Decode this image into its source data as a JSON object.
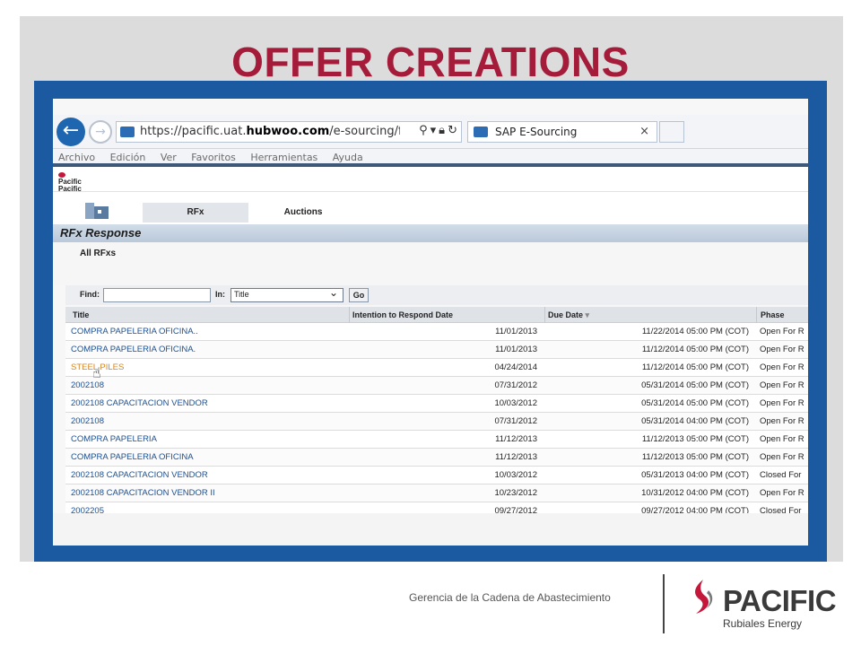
{
  "slide": {
    "title": "OFFER CREATIONS",
    "footer_text": "Gerencia de la Cadena de Abastecimiento",
    "logo": {
      "name": "PACIFIC",
      "tagline": "Rubiales Energy"
    },
    "colors": {
      "title": "#a41c3a",
      "frame": "#1b5aa0",
      "logo_red": "#c3183a"
    }
  },
  "browser": {
    "url_prefix": "https://pacific.uat.",
    "url_domain": "hubwoo.com",
    "url_path": "/e-sourcing/fsvenc",
    "tab_title": "SAP E-Sourcing",
    "tab_close": "×",
    "back_glyph": "←",
    "forward_glyph": "→",
    "address_icons": [
      "search-icon",
      "dropdown-icon",
      "lock-icon",
      "refresh-icon"
    ],
    "menu": [
      "Archivo",
      "Edición",
      "Ver",
      "Favoritos",
      "Herramientas",
      "Ayuda"
    ]
  },
  "app": {
    "logo_small_1": "Pacific",
    "logo_small_2": "Pacific",
    "tabs": [
      "RFx",
      "Auctions"
    ],
    "section_title": "RFx Response",
    "sub_title": "All RFxs",
    "search": {
      "find_label": "Find:",
      "find_value": "",
      "in_label": "In:",
      "in_value": "Title",
      "go_label": "Go"
    },
    "columns": [
      "Title",
      "Intention to Respond Date",
      "Due Date",
      "Phase"
    ],
    "sort_glyph": "▾",
    "rows": [
      {
        "title": "COMPRA PAPELERIA OFICINA..",
        "intention": "11/01/2013",
        "due": "11/22/2014 05:00 PM (COT)",
        "phase": "Open For R"
      },
      {
        "title": "COMPRA PAPELERIA OFICINA.",
        "intention": "11/01/2013",
        "due": "11/12/2014 05:00 PM (COT)",
        "phase": "Open For R"
      },
      {
        "title": "STEEL PILES",
        "intention": "04/24/2014",
        "due": "11/12/2014 05:00 PM (COT)",
        "phase": "Open For R"
      },
      {
        "title": "2002108",
        "intention": "07/31/2012",
        "due": "05/31/2014 05:00 PM (COT)",
        "phase": "Open For R"
      },
      {
        "title": "2002108 CAPACITACION VENDOR",
        "intention": "10/03/2012",
        "due": "05/31/2014 05:00 PM (COT)",
        "phase": "Open For R"
      },
      {
        "title": "2002108",
        "intention": "07/31/2012",
        "due": "05/31/2014 04:00 PM (COT)",
        "phase": "Open For R"
      },
      {
        "title": "COMPRA PAPELERIA",
        "intention": "11/12/2013",
        "due": "11/12/2013 05:00 PM (COT)",
        "phase": "Open For R"
      },
      {
        "title": "COMPRA PAPELERIA OFICINA",
        "intention": "11/12/2013",
        "due": "11/12/2013 05:00 PM (COT)",
        "phase": "Open For R"
      },
      {
        "title": "2002108 CAPACITACION VENDOR",
        "intention": "10/03/2012",
        "due": "05/31/2013 04:00 PM (COT)",
        "phase": "Closed For"
      },
      {
        "title": "2002108 CAPACITACION VENDOR II",
        "intention": "10/23/2012",
        "due": "10/31/2012 04:00 PM (COT)",
        "phase": "Open For R"
      },
      {
        "title": "2002205",
        "intention": "09/27/2012",
        "due": "09/27/2012 04:00 PM (COT)",
        "phase": "Closed For"
      }
    ],
    "hovered_row": 2
  }
}
